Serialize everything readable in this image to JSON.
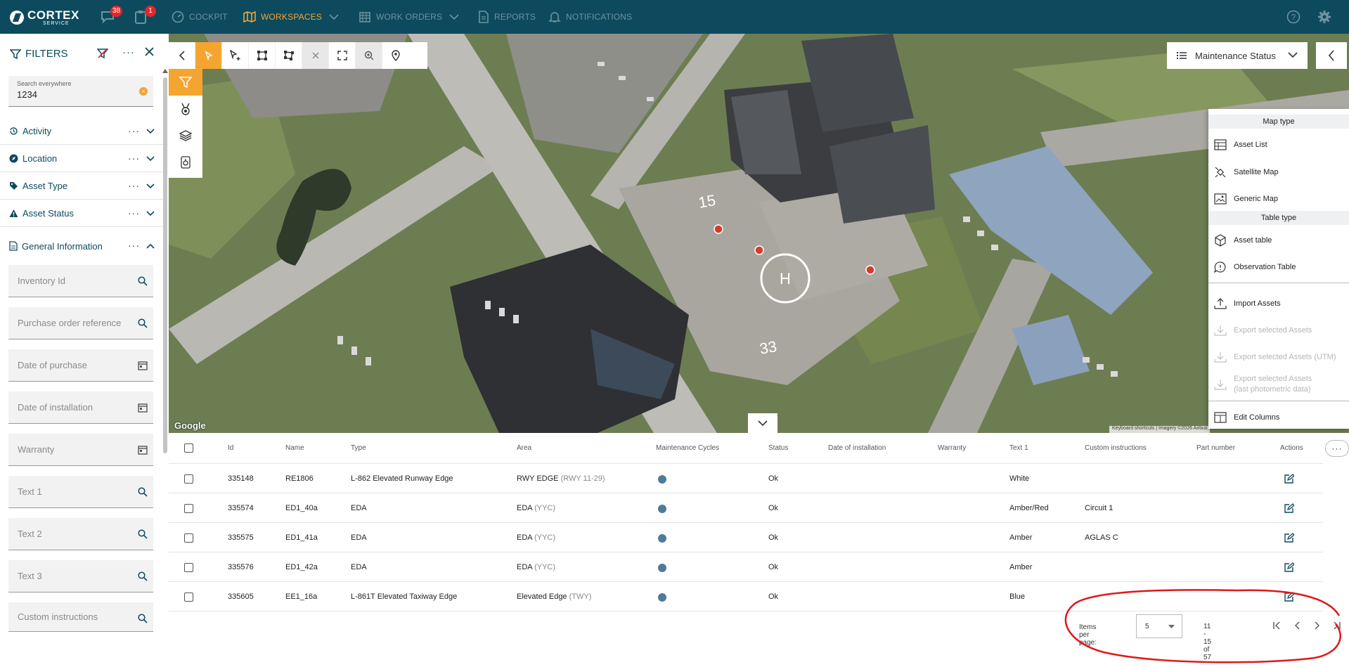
{
  "app": {
    "brand_line1": "CORTEX",
    "brand_line2": "SERVICE",
    "messages_badge": "38",
    "tasks_badge": "1",
    "nav": [
      {
        "label": "COCKPIT"
      },
      {
        "label": "WORKSPACES"
      },
      {
        "label": "WORK ORDERS"
      },
      {
        "label": "REPORTS"
      },
      {
        "label": "NOTIFICATIONS"
      }
    ],
    "colors": {
      "header": "#0d4a5e",
      "accent": "#f4a530",
      "status_dot": "#4f7b96",
      "map_marker": "#d63c2e"
    }
  },
  "filters": {
    "title": "FILTERS",
    "search": {
      "label": "Search everywhere",
      "value": "1234"
    },
    "sections": [
      {
        "label": "Activity"
      },
      {
        "label": "Location"
      },
      {
        "label": "Asset Type"
      },
      {
        "label": "Asset Status"
      },
      {
        "label": "General Information"
      }
    ],
    "fields": [
      {
        "placeholder": "Inventory Id",
        "icon": "search-icon"
      },
      {
        "placeholder": "Purchase order reference",
        "icon": "search-icon"
      },
      {
        "placeholder": "Date of purchase",
        "icon": "calendar-icon"
      },
      {
        "placeholder": "Date of installation",
        "icon": "calendar-icon"
      },
      {
        "placeholder": "Warranty",
        "icon": "calendar-icon"
      },
      {
        "placeholder": "Text 1",
        "icon": "search-icon"
      },
      {
        "placeholder": "Text 2",
        "icon": "search-icon"
      },
      {
        "placeholder": "Text 3",
        "icon": "search-icon"
      },
      {
        "placeholder": "Custom instructions",
        "icon": "search-icon"
      }
    ]
  },
  "map": {
    "status_select": "Maintenance Status",
    "google_label": "Google",
    "attribution": "Keyboard shortcuts | Imagery ©2026 Airbus",
    "runway_labels": [
      "15",
      "33"
    ],
    "menu": {
      "map_type_header": "Map type",
      "map_types": [
        "Asset List",
        "Satellite Map",
        "Generic Map"
      ],
      "table_type_header": "Table type",
      "table_types": [
        "Asset table",
        "Observation Table"
      ],
      "actions": [
        "Import Assets",
        "Export selected Assets",
        "Export selected Assets (UTM)"
      ],
      "export_photometric_line1": "Export selected Assets",
      "export_photometric_line2": "(last photometric data)",
      "edit_columns": "Edit Columns"
    }
  },
  "table": {
    "columns": [
      "Id",
      "Name",
      "Type",
      "Area",
      "Maintenance Cycles",
      "Status",
      "Date of installation",
      "Warranty",
      "Text 1",
      "Custom instructions",
      "Part number",
      "Actions"
    ],
    "rows": [
      {
        "id": "335148",
        "name": "RE1806",
        "type": "L-862 Elevated Runway Edge",
        "area": "RWY EDGE",
        "area_sub": "(RWY 11-29)",
        "status": "Ok",
        "text1": "White",
        "custom": ""
      },
      {
        "id": "335574",
        "name": "ED1_40a",
        "type": "EDA",
        "area": "EDA",
        "area_sub": "(YYC)",
        "status": "Ok",
        "text1": "Amber/Red",
        "custom": "Circuit 1"
      },
      {
        "id": "335575",
        "name": "ED1_41a",
        "type": "EDA",
        "area": "EDA",
        "area_sub": "(YYC)",
        "status": "Ok",
        "text1": "Amber",
        "custom": "AGLAS C"
      },
      {
        "id": "335576",
        "name": "ED1_42a",
        "type": "EDA",
        "area": "EDA",
        "area_sub": "(YYC)",
        "status": "Ok",
        "text1": "Amber",
        "custom": ""
      },
      {
        "id": "335605",
        "name": "EE1_16a",
        "type": "L-861T Elevated Taxiway Edge",
        "area": "Elevated Edge",
        "area_sub": "(TWY)",
        "status": "Ok",
        "text1": "Blue",
        "custom": ""
      }
    ],
    "pagination": {
      "items_per_page_label": "Items per page:",
      "items_per_page": "5",
      "range": "11 - 15 of 57"
    }
  }
}
